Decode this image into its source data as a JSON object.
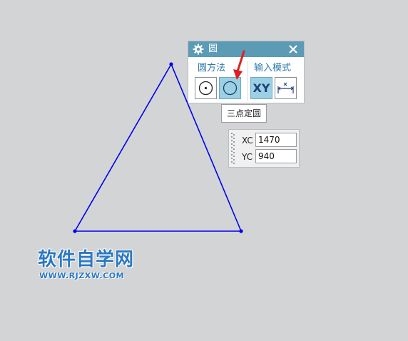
{
  "dialog": {
    "title": "圆",
    "title_icon": "gear-icon",
    "close_icon": "close-icon",
    "groups": {
      "method_label": "圆方法",
      "input_label": "输入模式"
    },
    "buttons": {
      "center_circle_icon": "circle-center-icon",
      "three_point_circle_icon": "circle-three-point-icon",
      "xy_label": "XY",
      "dimension_icon": "dimension-icon"
    },
    "three_point_active": true,
    "xy_active": true
  },
  "tooltip": {
    "text": "三点定圆"
  },
  "coordinates": {
    "xc_label": "XC",
    "xc_value": "1470",
    "yc_label": "YC",
    "yc_value": "940"
  },
  "sketch": {
    "shape": "triangle",
    "line_color": "#0000ee"
  },
  "annotation": {
    "arrow_color": "#e02020"
  },
  "watermark": {
    "title": "软件自学网",
    "url": "WWW.RJZXW.COM",
    "color": "#2a78c2"
  },
  "colors": {
    "background": "#d3d4d6",
    "titlebar": "#5b9bb5",
    "active_button": "#9cd0e3"
  }
}
